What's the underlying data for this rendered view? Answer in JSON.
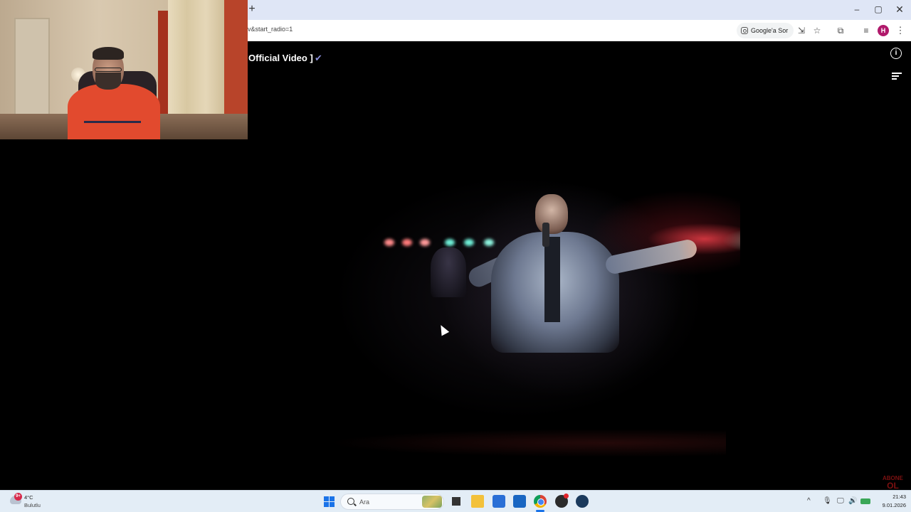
{
  "browser": {
    "new_tab_label": "+",
    "url_fragment": "v&start_radio=1",
    "google_sor_label": "Google'a Sor",
    "avatar_initial": "H",
    "window_controls": {
      "minimize": "–",
      "maximize": "▢",
      "close": "✕"
    }
  },
  "player": {
    "title_fragment": "Official Video ]",
    "verified_icon": "checkmark-icon",
    "info_icon": "i",
    "channel_watermark_top": "ABONE",
    "channel_watermark_bottom": "OL"
  },
  "taskbar": {
    "weather_badge": "9+",
    "weather_temp": "4°C",
    "weather_condition": "Bulutlu",
    "search_placeholder": "Ara",
    "time": "21:43",
    "date": "9.01.2026",
    "tray_chevron": "^"
  },
  "colors": {
    "chrome_frame": "#dfe6f6",
    "taskbar": "#e3edf6",
    "avatar": "#b0196b",
    "verified": "#8a8fd8"
  }
}
